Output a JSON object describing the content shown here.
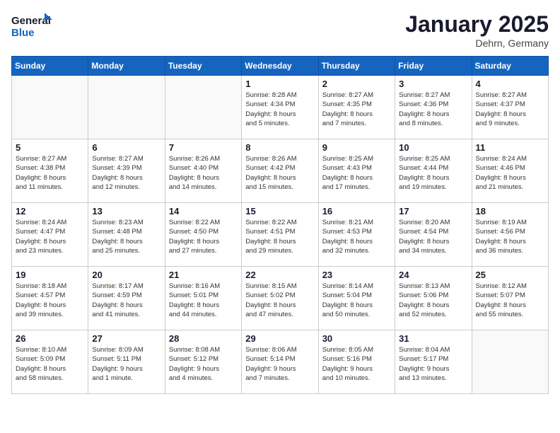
{
  "logo": {
    "line1": "General",
    "line2": "Blue"
  },
  "title": "January 2025",
  "location": "Dehrn, Germany",
  "days_header": [
    "Sunday",
    "Monday",
    "Tuesday",
    "Wednesday",
    "Thursday",
    "Friday",
    "Saturday"
  ],
  "weeks": [
    {
      "days": [
        {
          "num": "",
          "info": ""
        },
        {
          "num": "",
          "info": ""
        },
        {
          "num": "",
          "info": ""
        },
        {
          "num": "1",
          "info": "Sunrise: 8:28 AM\nSunset: 4:34 PM\nDaylight: 8 hours\nand 5 minutes."
        },
        {
          "num": "2",
          "info": "Sunrise: 8:27 AM\nSunset: 4:35 PM\nDaylight: 8 hours\nand 7 minutes."
        },
        {
          "num": "3",
          "info": "Sunrise: 8:27 AM\nSunset: 4:36 PM\nDaylight: 8 hours\nand 8 minutes."
        },
        {
          "num": "4",
          "info": "Sunrise: 8:27 AM\nSunset: 4:37 PM\nDaylight: 8 hours\nand 9 minutes."
        }
      ]
    },
    {
      "days": [
        {
          "num": "5",
          "info": "Sunrise: 8:27 AM\nSunset: 4:38 PM\nDaylight: 8 hours\nand 11 minutes."
        },
        {
          "num": "6",
          "info": "Sunrise: 8:27 AM\nSunset: 4:39 PM\nDaylight: 8 hours\nand 12 minutes."
        },
        {
          "num": "7",
          "info": "Sunrise: 8:26 AM\nSunset: 4:40 PM\nDaylight: 8 hours\nand 14 minutes."
        },
        {
          "num": "8",
          "info": "Sunrise: 8:26 AM\nSunset: 4:42 PM\nDaylight: 8 hours\nand 15 minutes."
        },
        {
          "num": "9",
          "info": "Sunrise: 8:25 AM\nSunset: 4:43 PM\nDaylight: 8 hours\nand 17 minutes."
        },
        {
          "num": "10",
          "info": "Sunrise: 8:25 AM\nSunset: 4:44 PM\nDaylight: 8 hours\nand 19 minutes."
        },
        {
          "num": "11",
          "info": "Sunrise: 8:24 AM\nSunset: 4:46 PM\nDaylight: 8 hours\nand 21 minutes."
        }
      ]
    },
    {
      "days": [
        {
          "num": "12",
          "info": "Sunrise: 8:24 AM\nSunset: 4:47 PM\nDaylight: 8 hours\nand 23 minutes."
        },
        {
          "num": "13",
          "info": "Sunrise: 8:23 AM\nSunset: 4:48 PM\nDaylight: 8 hours\nand 25 minutes."
        },
        {
          "num": "14",
          "info": "Sunrise: 8:22 AM\nSunset: 4:50 PM\nDaylight: 8 hours\nand 27 minutes."
        },
        {
          "num": "15",
          "info": "Sunrise: 8:22 AM\nSunset: 4:51 PM\nDaylight: 8 hours\nand 29 minutes."
        },
        {
          "num": "16",
          "info": "Sunrise: 8:21 AM\nSunset: 4:53 PM\nDaylight: 8 hours\nand 32 minutes."
        },
        {
          "num": "17",
          "info": "Sunrise: 8:20 AM\nSunset: 4:54 PM\nDaylight: 8 hours\nand 34 minutes."
        },
        {
          "num": "18",
          "info": "Sunrise: 8:19 AM\nSunset: 4:56 PM\nDaylight: 8 hours\nand 36 minutes."
        }
      ]
    },
    {
      "days": [
        {
          "num": "19",
          "info": "Sunrise: 8:18 AM\nSunset: 4:57 PM\nDaylight: 8 hours\nand 39 minutes."
        },
        {
          "num": "20",
          "info": "Sunrise: 8:17 AM\nSunset: 4:59 PM\nDaylight: 8 hours\nand 41 minutes."
        },
        {
          "num": "21",
          "info": "Sunrise: 8:16 AM\nSunset: 5:01 PM\nDaylight: 8 hours\nand 44 minutes."
        },
        {
          "num": "22",
          "info": "Sunrise: 8:15 AM\nSunset: 5:02 PM\nDaylight: 8 hours\nand 47 minutes."
        },
        {
          "num": "23",
          "info": "Sunrise: 8:14 AM\nSunset: 5:04 PM\nDaylight: 8 hours\nand 50 minutes."
        },
        {
          "num": "24",
          "info": "Sunrise: 8:13 AM\nSunset: 5:06 PM\nDaylight: 8 hours\nand 52 minutes."
        },
        {
          "num": "25",
          "info": "Sunrise: 8:12 AM\nSunset: 5:07 PM\nDaylight: 8 hours\nand 55 minutes."
        }
      ]
    },
    {
      "days": [
        {
          "num": "26",
          "info": "Sunrise: 8:10 AM\nSunset: 5:09 PM\nDaylight: 8 hours\nand 58 minutes."
        },
        {
          "num": "27",
          "info": "Sunrise: 8:09 AM\nSunset: 5:11 PM\nDaylight: 9 hours\nand 1 minute."
        },
        {
          "num": "28",
          "info": "Sunrise: 8:08 AM\nSunset: 5:12 PM\nDaylight: 9 hours\nand 4 minutes."
        },
        {
          "num": "29",
          "info": "Sunrise: 8:06 AM\nSunset: 5:14 PM\nDaylight: 9 hours\nand 7 minutes."
        },
        {
          "num": "30",
          "info": "Sunrise: 8:05 AM\nSunset: 5:16 PM\nDaylight: 9 hours\nand 10 minutes."
        },
        {
          "num": "31",
          "info": "Sunrise: 8:04 AM\nSunset: 5:17 PM\nDaylight: 9 hours\nand 13 minutes."
        },
        {
          "num": "",
          "info": ""
        }
      ]
    }
  ]
}
